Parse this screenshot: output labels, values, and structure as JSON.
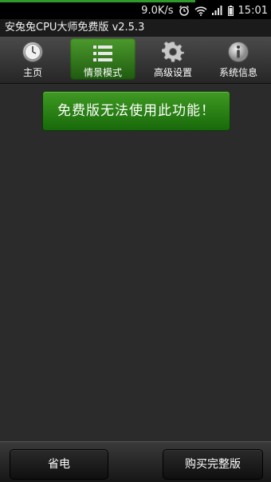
{
  "status_bar": {
    "speed": "9.0K/s",
    "time": "15:01",
    "icons": [
      "alarm-icon",
      "wifi-icon",
      "signal-icon",
      "battery-icon"
    ]
  },
  "app": {
    "title": "安兔兔CPU大师免费版 v2.5.3"
  },
  "tabs": [
    {
      "label": "主页",
      "icon": "clock-icon",
      "active": false
    },
    {
      "label": "情景模式",
      "icon": "list-icon",
      "active": true
    },
    {
      "label": "高级设置",
      "icon": "gear-icon",
      "active": false
    },
    {
      "label": "系统信息",
      "icon": "info-icon",
      "active": false
    }
  ],
  "main": {
    "message": "免费版无法使用此功能！"
  },
  "bottom": {
    "left_label": "省电",
    "right_label": "购买完整版"
  },
  "colors": {
    "accent_green": "#2e8a1c",
    "background": "#2b2b2b"
  }
}
